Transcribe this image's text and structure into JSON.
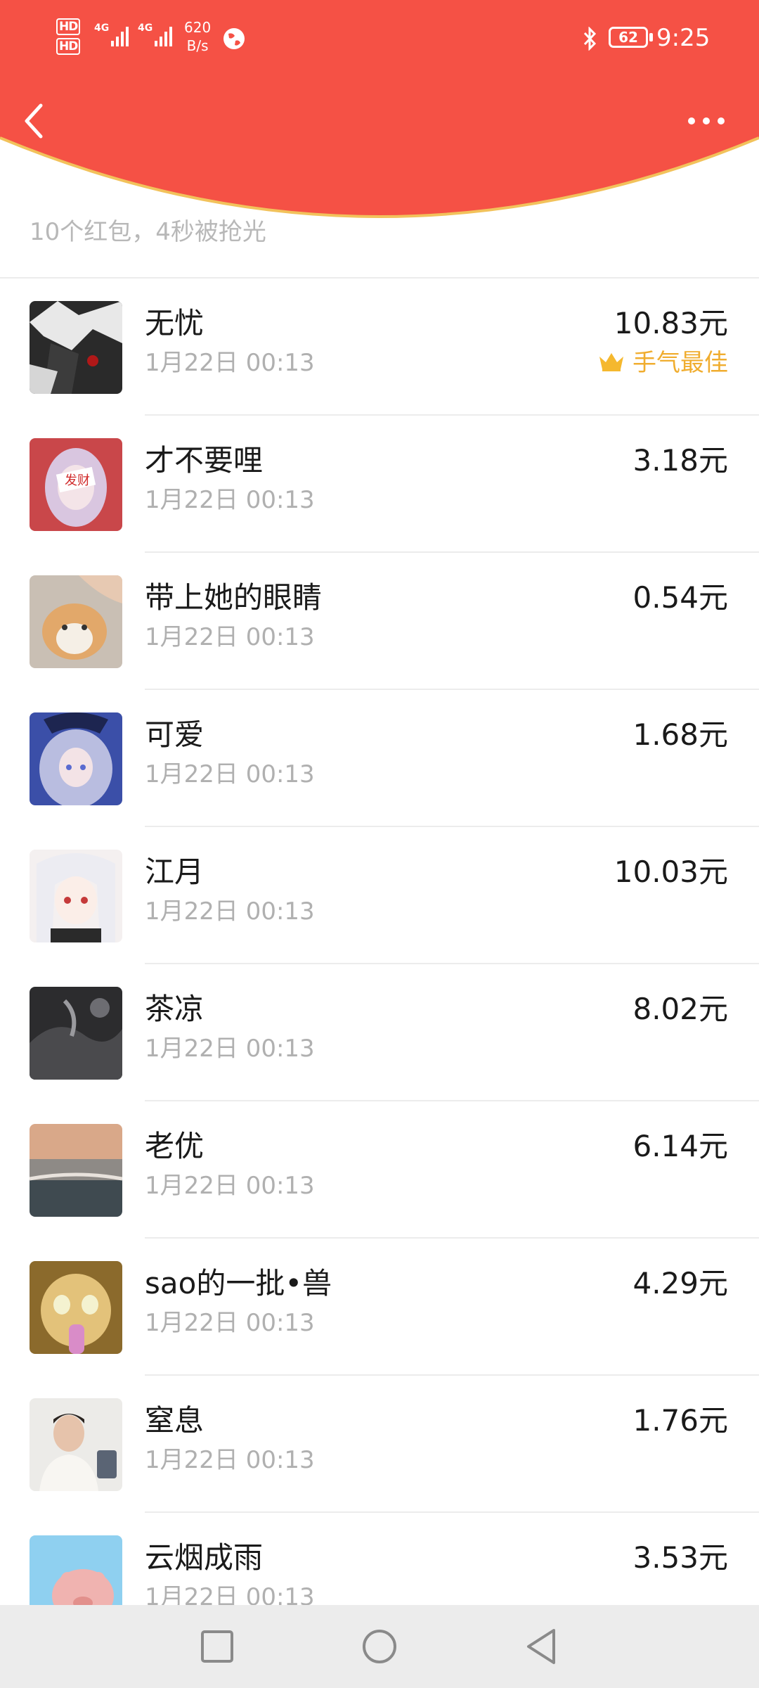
{
  "status_bar": {
    "hd1": "HD",
    "hd2": "HD",
    "net1": "4G",
    "net2": "4G",
    "speed_value": "620",
    "speed_unit": "B/s",
    "battery": "62",
    "time": "9:25"
  },
  "icons": {
    "back": "back-chevron-icon",
    "more": "more-dots-icon",
    "crown": "crown-icon",
    "bluetooth": "bluetooth-icon",
    "globe": "globe-icon"
  },
  "summary": {
    "text": "10个红包，4秒被抢光"
  },
  "colors": {
    "header_red": "#f55145",
    "header_edge": "#f2c25b",
    "best_gold": "#f0ad2f",
    "nav_bg": "#ececec"
  },
  "list": [
    {
      "name": "无忧",
      "time": "1月22日  00:13",
      "amount": "10.83元",
      "best": "手气最佳"
    },
    {
      "name": "才不要哩",
      "time": "1月22日  00:13",
      "amount": "3.18元"
    },
    {
      "name": "带上她的眼睛",
      "time": "1月22日  00:13",
      "amount": "0.54元"
    },
    {
      "name": "可爱",
      "time": "1月22日  00:13",
      "amount": "1.68元"
    },
    {
      "name": "江月",
      "time": "1月22日  00:13",
      "amount": "10.03元"
    },
    {
      "name": "茶凉",
      "time": "1月22日  00:13",
      "amount": "8.02元"
    },
    {
      "name": "老优",
      "time": "1月22日  00:13",
      "amount": "6.14元"
    },
    {
      "name": "sao的一批•兽",
      "time": "1月22日  00:13",
      "amount": "4.29元"
    },
    {
      "name": "窒息",
      "time": "1月22日  00:13",
      "amount": "1.76元"
    },
    {
      "name": "云烟成雨",
      "time": "1月22日  00:13",
      "amount": "3.53元"
    }
  ],
  "nav": {
    "recent": "square-recents-icon",
    "home": "circle-home-icon",
    "back": "triangle-back-icon"
  }
}
